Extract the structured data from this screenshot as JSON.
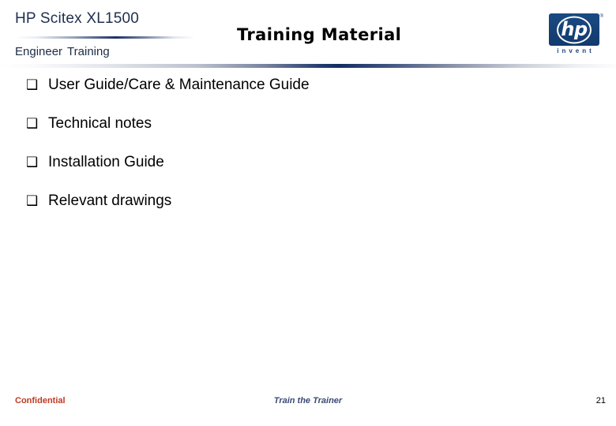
{
  "slide": {
    "header": {
      "product_name": "HP Scitex XL1500",
      "audience_line_part1": "Engineer",
      "audience_line_part2": "Training",
      "title": "Training Material"
    },
    "logo": {
      "wordmark": "hp",
      "tagline": "invent",
      "trademark": "®",
      "brand_color": "#16427a",
      "name": "hp-invent-logo"
    },
    "body": {
      "bullet_glyph": "❑",
      "bullets": [
        {
          "label": "User Guide/Care & Maintenance Guide"
        },
        {
          "label": "Technical notes"
        },
        {
          "label": "Installation Guide"
        },
        {
          "label": "Relevant drawings"
        }
      ]
    },
    "footer": {
      "classification": "Confidential",
      "classification_color": "#c0391f",
      "course": "Train the Trainer",
      "course_color": "#3b4a73",
      "page_number": "21"
    }
  }
}
